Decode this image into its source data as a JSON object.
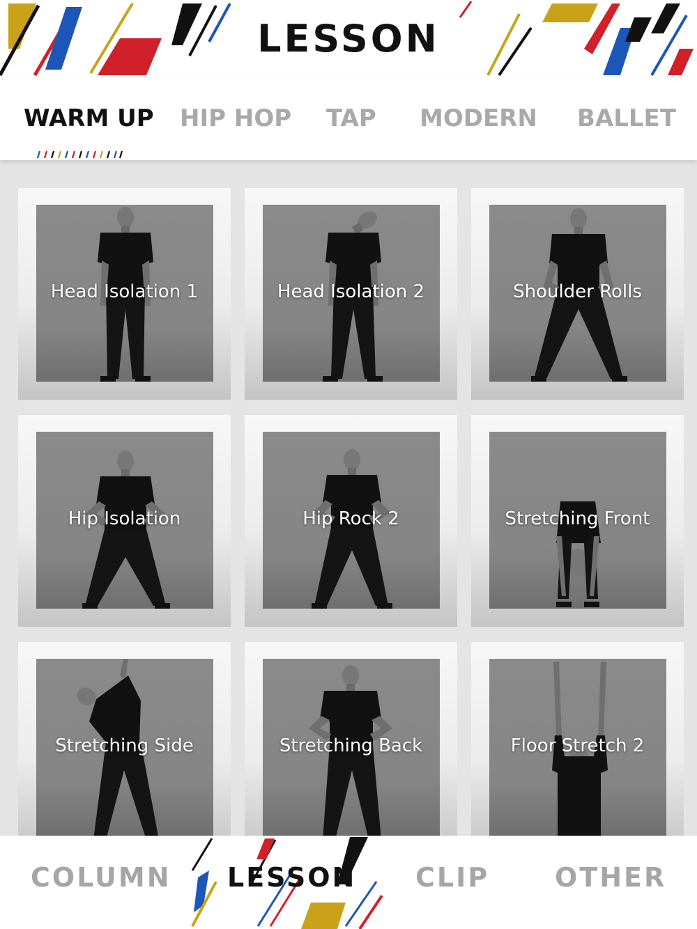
{
  "header": {
    "title": "LESSON"
  },
  "tabs": [
    {
      "label": "WARM UP",
      "active": true
    },
    {
      "label": "HIP HOP",
      "active": false
    },
    {
      "label": "TAP",
      "active": false
    },
    {
      "label": "MODERN",
      "active": false
    },
    {
      "label": "BALLET",
      "active": false
    }
  ],
  "lessons": [
    {
      "label": "Head Isolation 1"
    },
    {
      "label": "Head Isolation 2"
    },
    {
      "label": "Shoulder Rolls"
    },
    {
      "label": "Hip Isolation"
    },
    {
      "label": "Hip Rock 2"
    },
    {
      "label": "Stretching Front"
    },
    {
      "label": "Stretching Side"
    },
    {
      "label": "Stretching Back"
    },
    {
      "label": "Floor Stretch 2"
    }
  ],
  "bottom_nav": [
    {
      "label": "COLUMN",
      "active": false
    },
    {
      "label": "LESSON",
      "active": true
    },
    {
      "label": "CLIP",
      "active": false
    },
    {
      "label": "OTHER",
      "active": false
    }
  ],
  "colors": {
    "accent_yellow": "#c9a21a",
    "accent_red": "#d0202a",
    "accent_blue": "#1c56b8",
    "accent_black": "#111111",
    "tab_inactive": "#a9a9a9"
  }
}
